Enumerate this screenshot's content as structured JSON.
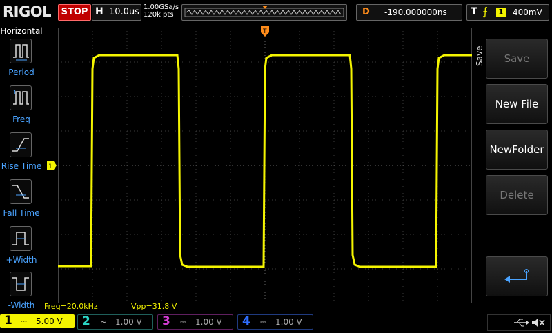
{
  "brand": "RIGOL",
  "run_state": "STOP",
  "horizontal": {
    "label": "H",
    "timebase": "10.0us"
  },
  "acquisition": {
    "sample_rate": "1.00GSa/s",
    "points": "120k pts"
  },
  "delay": {
    "label": "D",
    "value": "-190.000000ns"
  },
  "trigger": {
    "label": "T",
    "source": "1",
    "level": "400mV"
  },
  "left_menu": {
    "title": "Horizontal",
    "items": [
      "Period",
      "Freq",
      "Rise Time",
      "Fall Time",
      "+Width",
      "-Width"
    ]
  },
  "right_menu": {
    "title": "Save",
    "buttons": [
      "Save",
      "New File",
      "NewFolder",
      "Delete"
    ]
  },
  "measurements": {
    "freq": "Freq=20.0kHz",
    "vpp": "Vpp=31.8 V"
  },
  "channels": [
    {
      "num": "1",
      "scale": "5.00 V",
      "color": "#f4f400",
      "active": true
    },
    {
      "num": "2",
      "scale": "1.00 V",
      "color": "#2bd4c4",
      "active": false
    },
    {
      "num": "3",
      "scale": "1.00 V",
      "color": "#d23cd2",
      "active": false
    },
    {
      "num": "4",
      "scale": "1.00 V",
      "color": "#2f6fff",
      "active": false
    }
  ],
  "colors": {
    "accent": "#f4f400",
    "trigger_marker": "#ff8c1a",
    "stop": "#c00000",
    "menu_label": "#4aa3ff"
  },
  "icons": [
    "usb-icon",
    "speaker-muted-icon",
    "return-icon"
  ]
}
